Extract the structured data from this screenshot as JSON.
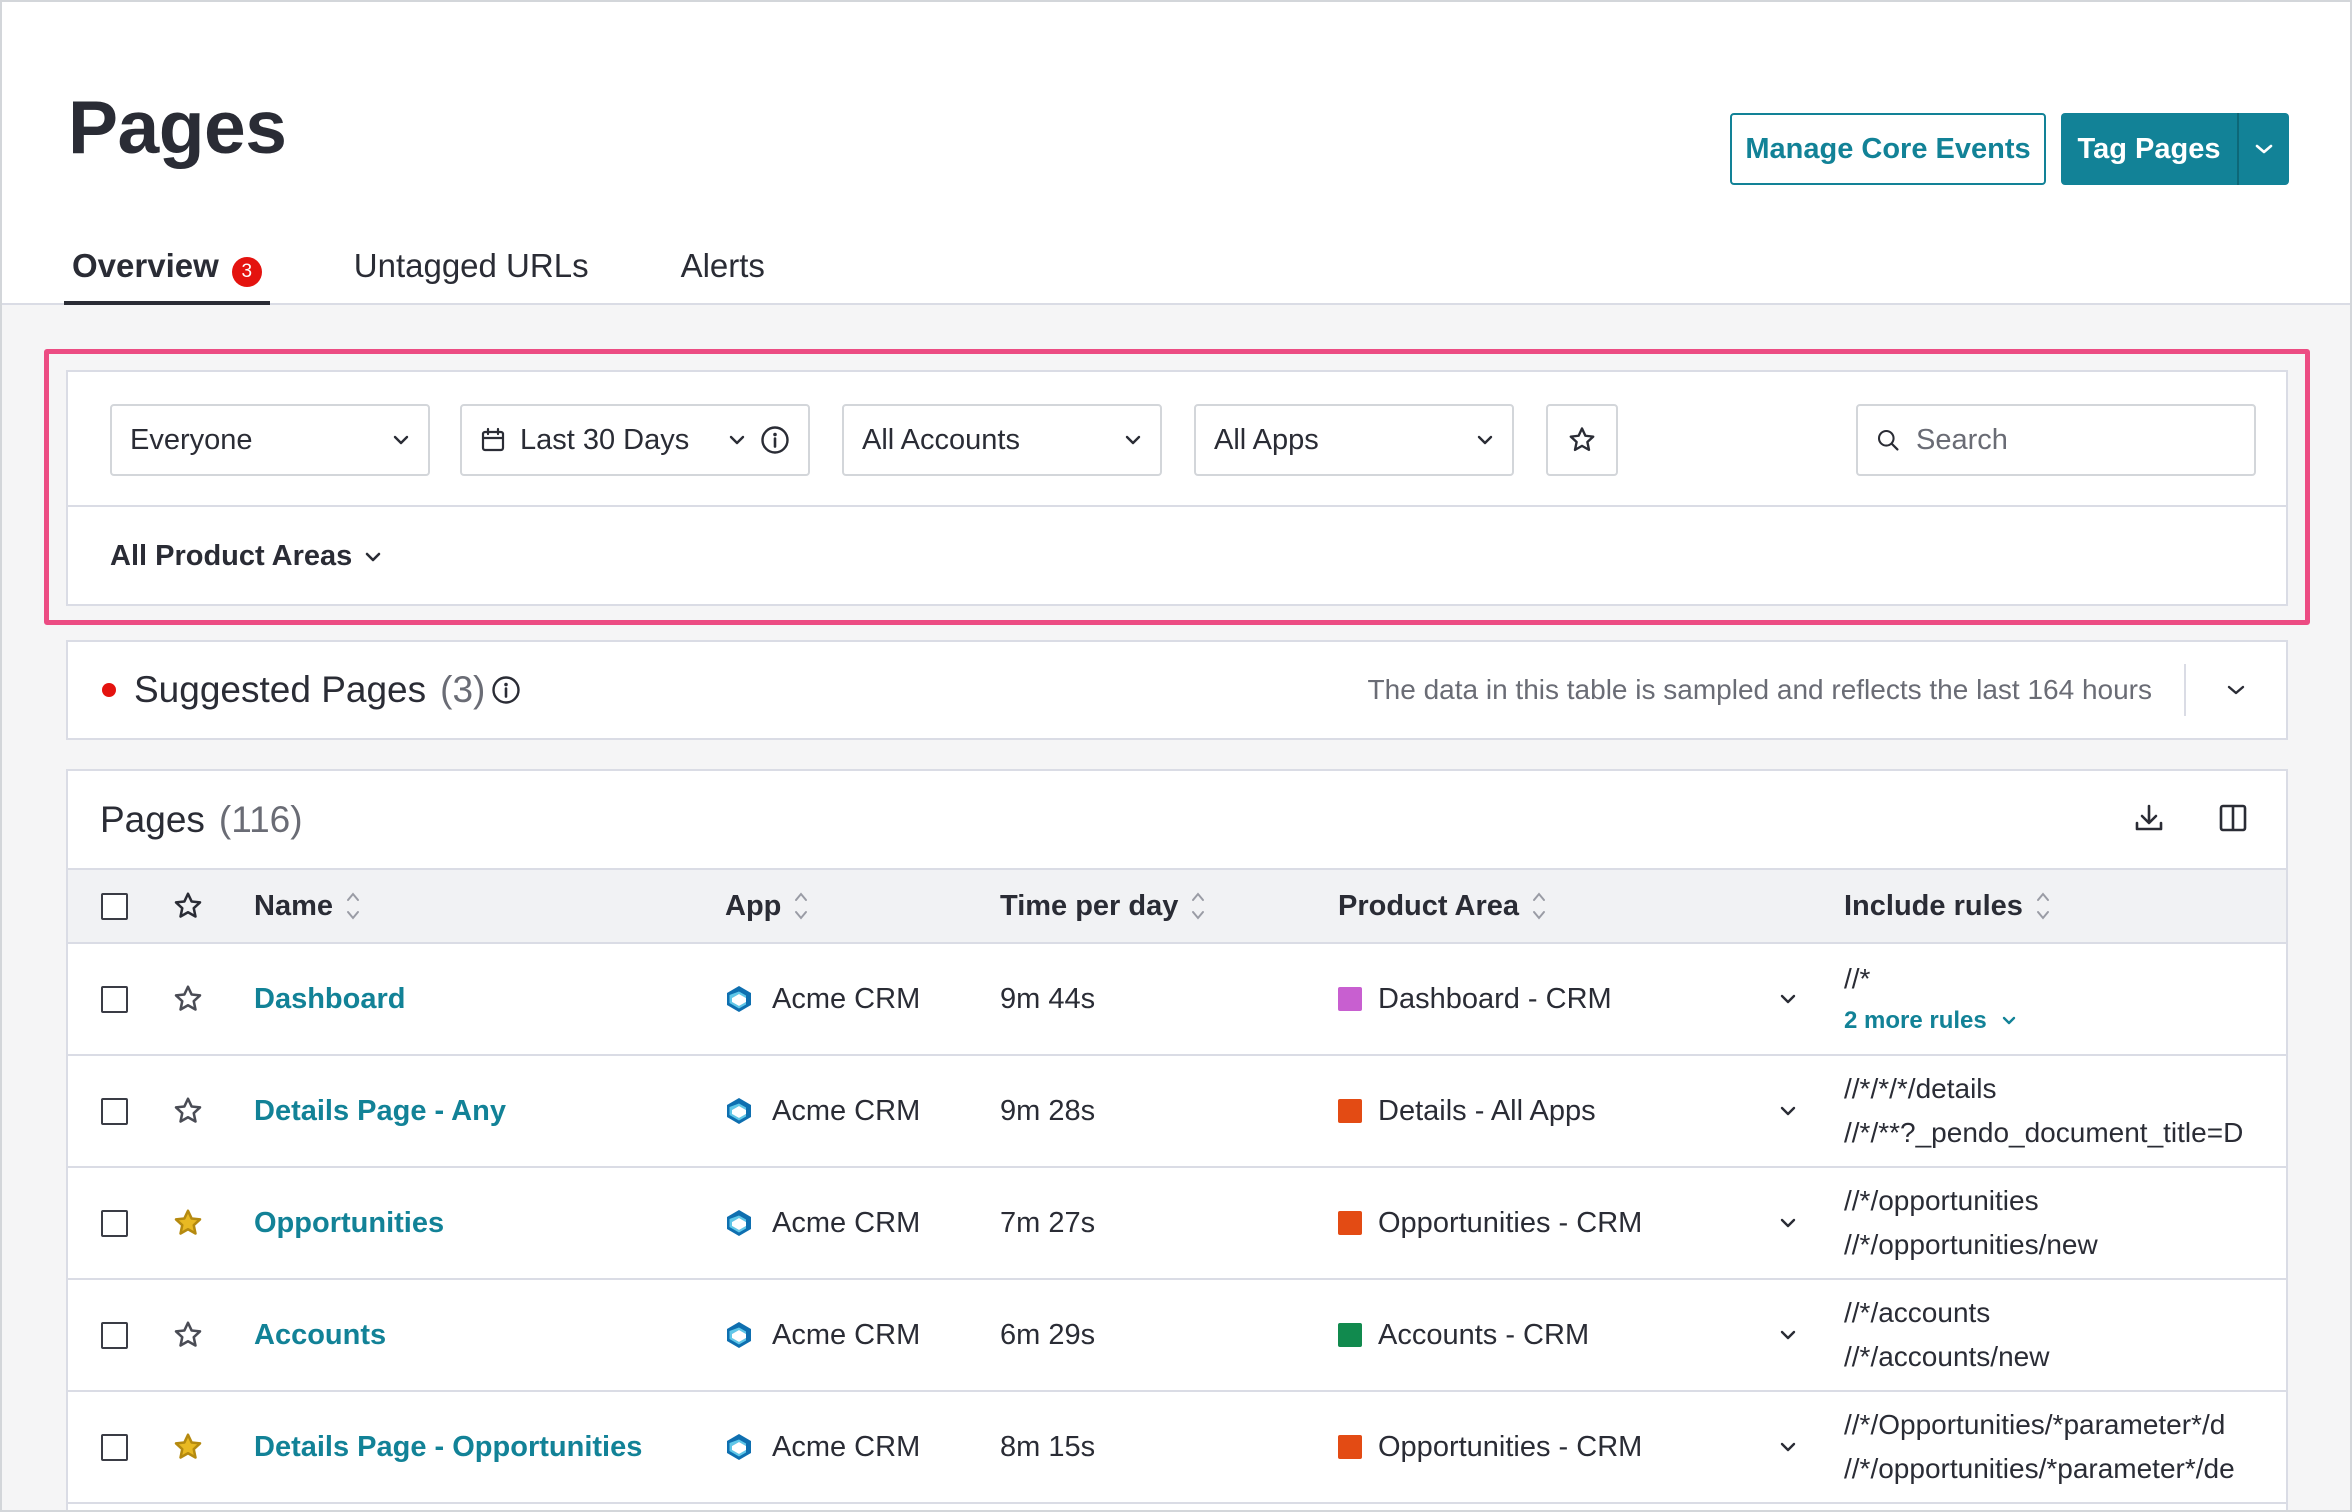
{
  "header": {
    "title": "Pages",
    "manage_button": "Manage Core Events",
    "tag_button": "Tag Pages"
  },
  "tabs": [
    {
      "label": "Overview",
      "badge": "3",
      "active": true
    },
    {
      "label": "Untagged URLs"
    },
    {
      "label": "Alerts"
    }
  ],
  "filters": {
    "segment": "Everyone",
    "date_range": "Last 30 Days",
    "accounts": "All Accounts",
    "apps": "All Apps",
    "search_placeholder": "Search",
    "product_areas": "All Product Areas"
  },
  "suggested": {
    "title": "Suggested Pages",
    "count": "(3)",
    "note": "The data in this table is sampled and reflects the last 164 hours"
  },
  "pages_table": {
    "title": "Pages",
    "count": "(116)",
    "columns": [
      "Name",
      "App",
      "Time per day",
      "Product Area",
      "Include rules"
    ],
    "rows": [
      {
        "name": "Dashboard",
        "starred": false,
        "app": "Acme CRM",
        "time": "9m 44s",
        "area": "Dashboard - CRM",
        "area_color": "#c85fd0",
        "rules": [
          "//*"
        ],
        "more_rules": "2 more rules"
      },
      {
        "name": "Details Page - Any",
        "starred": false,
        "app": "Acme CRM",
        "time": "9m 28s",
        "area": "Details - All Apps",
        "area_color": "#e34b14",
        "rules": [
          "//*/*/*/details",
          "//*/**?_pendo_document_title=D"
        ]
      },
      {
        "name": "Opportunities",
        "starred": true,
        "app": "Acme CRM",
        "time": "7m 27s",
        "area": "Opportunities - CRM",
        "area_color": "#e34b14",
        "rules": [
          "//*/opportunities",
          "//*/opportunities/new"
        ]
      },
      {
        "name": "Accounts",
        "starred": false,
        "app": "Acme CRM",
        "time": "6m 29s",
        "area": "Accounts - CRM",
        "area_color": "#118a4e",
        "rules": [
          "//*/accounts",
          "//*/accounts/new"
        ]
      },
      {
        "name": "Details Page - Opportunities",
        "starred": true,
        "app": "Acme CRM",
        "time": "8m 15s",
        "area": "Opportunities - CRM",
        "area_color": "#e34b14",
        "rules": [
          "//*/Opportunities/*parameter*/d",
          "//*/opportunities/*parameter*/de"
        ]
      }
    ]
  },
  "colors": {
    "accent": "#128297",
    "highlight": "#ec4c83",
    "badge": "#e4130f",
    "star_filled": "#e8b923"
  }
}
